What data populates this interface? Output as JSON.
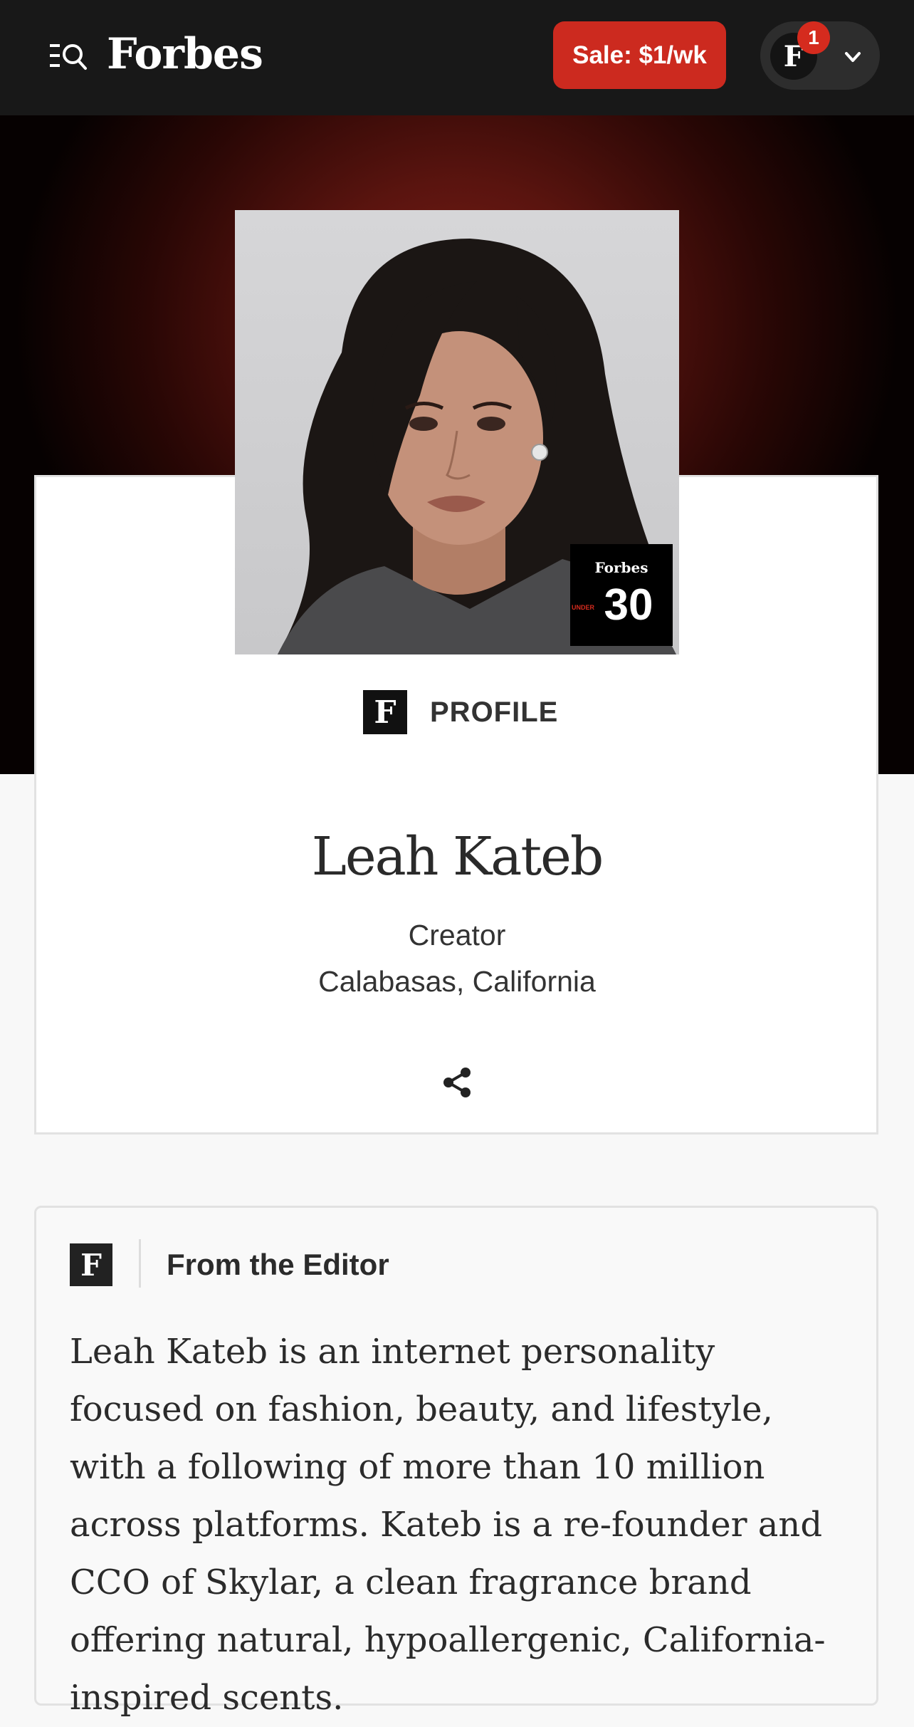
{
  "header": {
    "logo": "Forbes",
    "sale_button": "Sale: $1/wk",
    "account_initial": "F",
    "notification_count": "1"
  },
  "profile": {
    "badge_brand": "Forbes",
    "badge_prefix": "UNDER",
    "badge_number": "30",
    "section_icon": "F",
    "section_label": "PROFILE",
    "name": "Leah Kateb",
    "role": "Creator",
    "location": "Calabasas, California"
  },
  "editor": {
    "icon": "F",
    "title": "From the Editor",
    "body": "Leah Kateb is an internet personality focused on fashion, beauty, and lifestyle, with a following of more than 10 million across platforms. Kateb is a re-founder and CCO of Skylar, a clean fragrance brand offering natural, hypoallergenic, California-inspired scents."
  },
  "colors": {
    "header_bg": "#181818",
    "sale_red": "#cc2a1f",
    "hero_red": "#7a1d16"
  }
}
